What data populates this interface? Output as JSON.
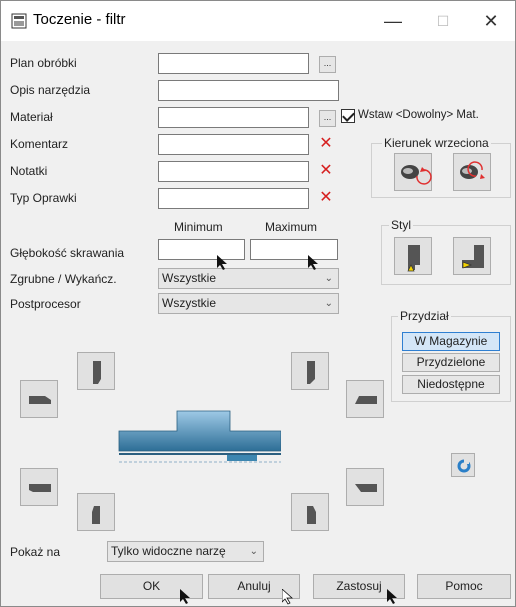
{
  "window": {
    "title": "Toczenie - filtr",
    "min_glyph": "—",
    "max_glyph": "☐",
    "close_glyph": "✕"
  },
  "fields": {
    "plan_label": "Plan obróbki",
    "opis_label": "Opis narzędzia",
    "material_label": "Materiał",
    "komentarz_label": "Komentarz",
    "notatki_label": "Notatki",
    "typ_label": "Typ Oprawki",
    "dots": "...",
    "x_glyph": "✕",
    "wstaw_label": "Wstaw <Dowolny> Mat.",
    "wstaw_checked": true
  },
  "depth": {
    "minimum_label": "Minimum",
    "maximum_label": "Maximum",
    "label": "Głębokość skrawania"
  },
  "zgrubne": {
    "label": "Zgrubne / Wykańcz.",
    "value": "Wszystkie"
  },
  "postprocesor": {
    "label": "Postprocesor",
    "value": "Wszystkie"
  },
  "kierunek": {
    "title": "Kierunek wrzeciona"
  },
  "styl": {
    "title": "Styl"
  },
  "przydzial": {
    "title": "Przydział",
    "w_magazynie": "W Magazynie",
    "przydzielone": "Przydzielone",
    "niedostepne": "Niedostępne"
  },
  "pokaz": {
    "label": "Pokaż na",
    "value": "Tylko widoczne narzę"
  },
  "buttons": {
    "ok": "OK",
    "anuluj": "Anuluj",
    "zastosuj": "Zastosuj",
    "pomoc": "Pomoc"
  },
  "colors": {
    "accent": "#2f7fd1",
    "close_red": "#d62020",
    "part_blue": "#3c86b0"
  }
}
